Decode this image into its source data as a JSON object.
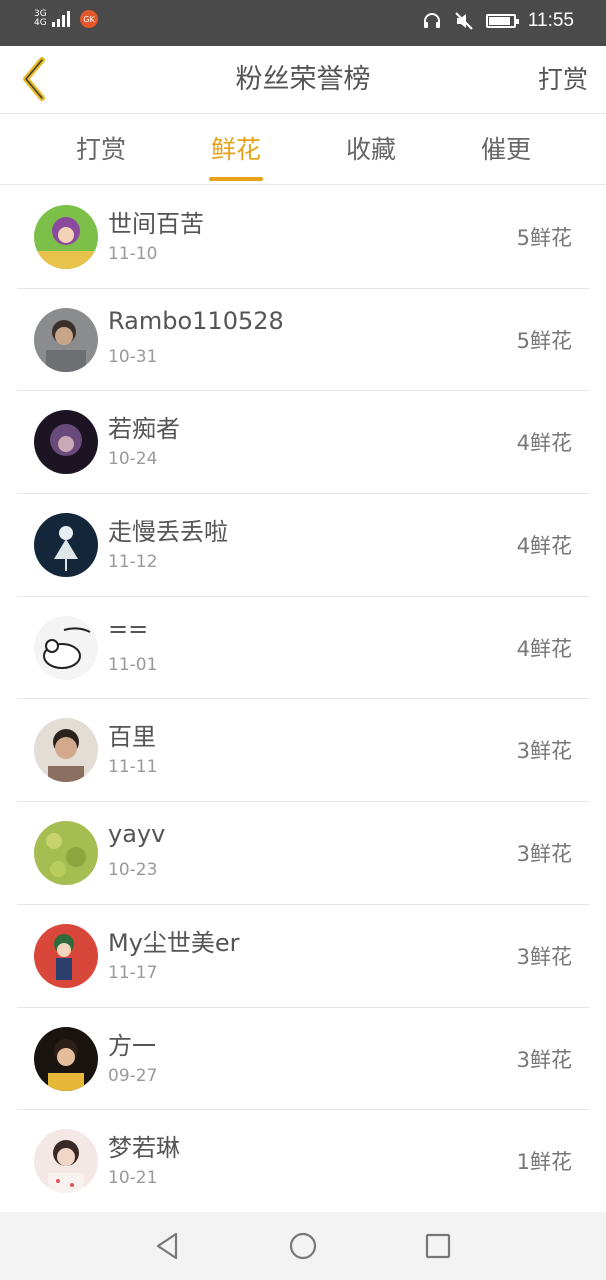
{
  "status_bar": {
    "network": "3G 4G",
    "app_badge": "GK",
    "time": "11:55",
    "battery_level": 0.9,
    "icons": [
      "signal-icon",
      "headset-icon",
      "mute-icon",
      "battery-icon"
    ]
  },
  "header": {
    "back_icon": "chevron-left-icon",
    "title": "粉丝荣誉榜",
    "action_label": "打赏"
  },
  "tabs": [
    {
      "label": "打赏",
      "active": false
    },
    {
      "label": "鲜花",
      "active": true
    },
    {
      "label": "收藏",
      "active": false
    },
    {
      "label": "催更",
      "active": false
    }
  ],
  "rows": [
    {
      "name": "世间百苦",
      "date": "11-10",
      "amount": "5鲜花"
    },
    {
      "name": "Rambo110528",
      "date": "10-31",
      "amount": "5鲜花"
    },
    {
      "name": "若痴者",
      "date": "10-24",
      "amount": "4鲜花"
    },
    {
      "name": "走慢丢丢啦",
      "date": "11-12",
      "amount": "4鲜花"
    },
    {
      "name": "==",
      "date": "11-01",
      "amount": "4鲜花"
    },
    {
      "name": "百里",
      "date": "11-11",
      "amount": "3鲜花"
    },
    {
      "name": "yayv",
      "date": "10-23",
      "amount": "3鲜花"
    },
    {
      "name": "My尘世美er",
      "date": "11-17",
      "amount": "3鲜花"
    },
    {
      "name": "方一",
      "date": "09-27",
      "amount": "3鲜花"
    },
    {
      "name": "梦若琳",
      "date": "10-21",
      "amount": "1鲜花"
    }
  ],
  "nav_bar": {
    "icons": [
      "back-triangle-icon",
      "home-circle-icon",
      "recents-square-icon"
    ]
  },
  "colors": {
    "accent": "#e8a21a",
    "status_bar": "#4a4a4a",
    "text": "#555555",
    "secondary_text": "#999999"
  }
}
